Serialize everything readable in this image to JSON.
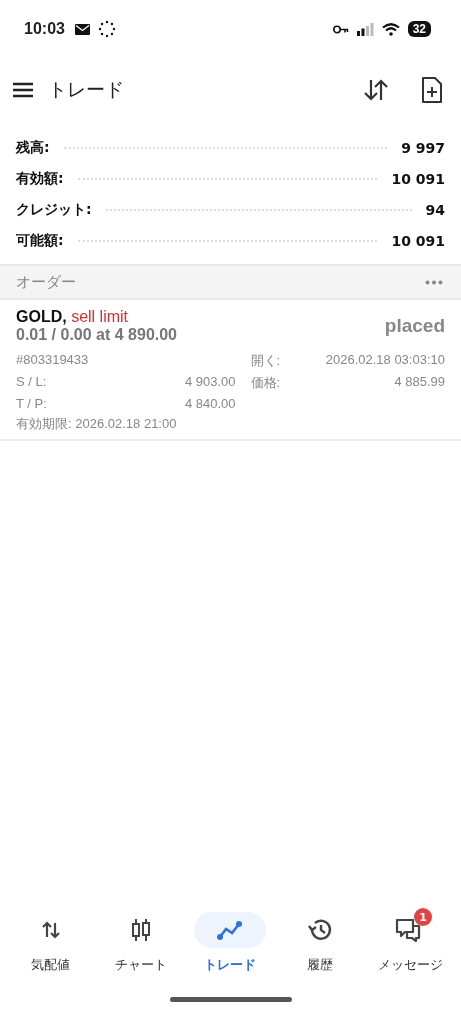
{
  "status_bar": {
    "time": "10:03",
    "battery": "32"
  },
  "header": {
    "title": "トレード"
  },
  "summary": [
    {
      "label": "残高:",
      "value": "9 997"
    },
    {
      "label": "有効額:",
      "value": "10 091"
    },
    {
      "label": "クレジット:",
      "value": "94"
    },
    {
      "label": "可能額:",
      "value": "10 091"
    }
  ],
  "orders_section": {
    "title": "オーダー"
  },
  "orders": [
    {
      "symbol": "GOLD,",
      "type": "sell limit",
      "volume": "0.01 / 0.00 at 4 890.00",
      "status": "placed",
      "ticket": "#803319433",
      "open_label": "開く:",
      "open_time": "2026.02.18 03:03:10",
      "sl_label": "S / L:",
      "sl": "4 903.00",
      "price_label": "価格:",
      "price": "4 885.99",
      "tp_label": "T / P:",
      "tp": "4 840.00",
      "expiry": "有効期限: 2026.02.18 21:00"
    }
  ],
  "nav": [
    {
      "kind": "quotes",
      "label": "気配値",
      "selected": false
    },
    {
      "kind": "chart",
      "label": "チャート",
      "selected": false
    },
    {
      "kind": "trade",
      "label": "トレード",
      "selected": true
    },
    {
      "kind": "history",
      "label": "履歴",
      "selected": false
    },
    {
      "kind": "messages",
      "label": "メッセージ",
      "selected": false,
      "badge": "1"
    }
  ]
}
